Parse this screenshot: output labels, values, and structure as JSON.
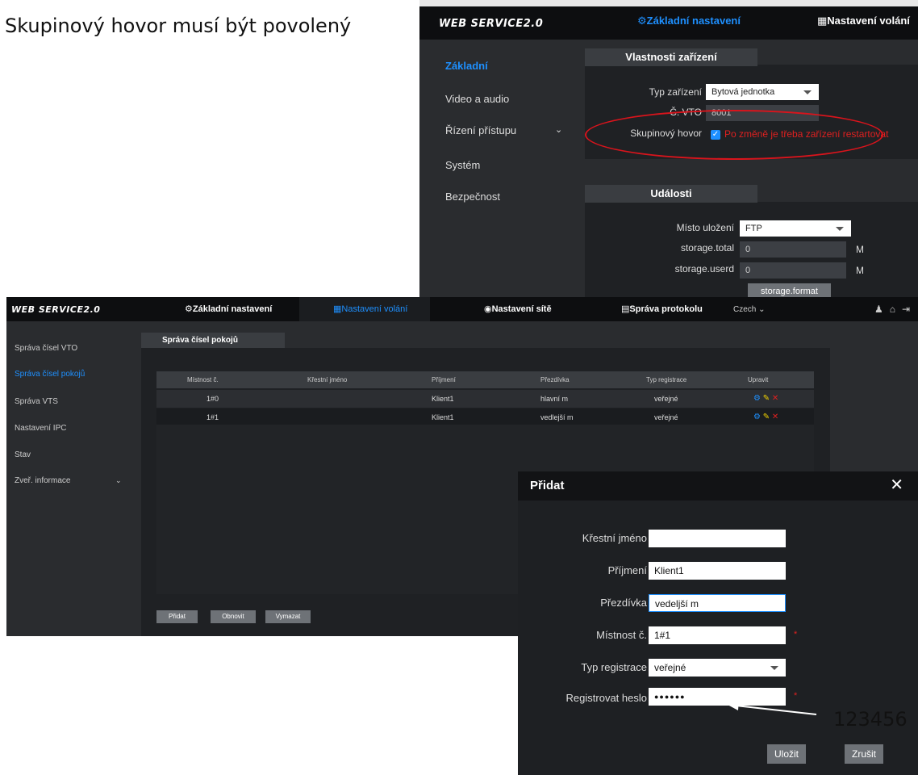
{
  "caption": "Skupinový hovor musí být povolený",
  "annotation": "123456",
  "shot1": {
    "logo": "WEB SERVICE2.0",
    "nav": [
      "Základní nastavení",
      "Nastavení volání"
    ],
    "sidebar": [
      "Základní",
      "Video a audio",
      "Řízení přístupu",
      "Systém",
      "Bezpečnost"
    ],
    "device": {
      "tab": "Vlastnosti zařízení",
      "type_label": "Typ zařízení",
      "type_value": "Bytová jednotka",
      "vto_label": "Č. VTO",
      "vto_value": "8001",
      "group_label": "Skupinový hovor",
      "group_note": "Po změně je třeba zařízení restartovat"
    },
    "events": {
      "tab": "Události",
      "storage_label": "Místo uložení",
      "storage_value": "FTP",
      "total_label": "storage.total",
      "total_value": "0",
      "used_label": "storage.userd",
      "used_value": "0",
      "unit": "M",
      "format_button": "storage.format"
    }
  },
  "shot2": {
    "logo": "WEB SERVICE2.0",
    "nav": [
      "Základní nastavení",
      "Nastavení volání",
      "Nastavení sítě",
      "Správa protokolu"
    ],
    "lang": "Czech",
    "sidebar": [
      "Správa čísel VTO",
      "Správa čísel pokojů",
      "Správa VTS",
      "Nastavení IPC",
      "Stav",
      "Zveř. informace"
    ],
    "tab": "Správa čísel pokojů",
    "columns": [
      "Místnost č.",
      "Křestní jméno",
      "Příjmení",
      "Přezdívka",
      "Typ registrace",
      "Upravit"
    ],
    "rows": [
      [
        "1#0",
        "",
        "Klient1",
        "hlavní m",
        "veřejné"
      ],
      [
        "1#1",
        "",
        "Klient1",
        "vedlejší m",
        "veřejné"
      ]
    ],
    "buttons": [
      "Přidat",
      "Obnovit",
      "Vymazat"
    ]
  },
  "dialog": {
    "title": "Přidat",
    "close": "✕",
    "fields": {
      "first_name_label": "Křestní jméno",
      "first_name_value": "",
      "last_name_label": "Příjmení",
      "last_name_value": "Klient1",
      "nickname_label": "Přezdívka",
      "nickname_value": "vedeljší m",
      "room_label": "Místnost č.",
      "room_value": "1#1",
      "reg_type_label": "Typ registrace",
      "reg_type_value": "veřejné",
      "password_label": "Registrovat heslo",
      "password_value": "●●●●●●"
    },
    "required_mark": "*",
    "save": "Uložit",
    "cancel": "Zrušit"
  },
  "colors": {
    "accent": "#1e90ff",
    "alert": "#d9141c"
  }
}
